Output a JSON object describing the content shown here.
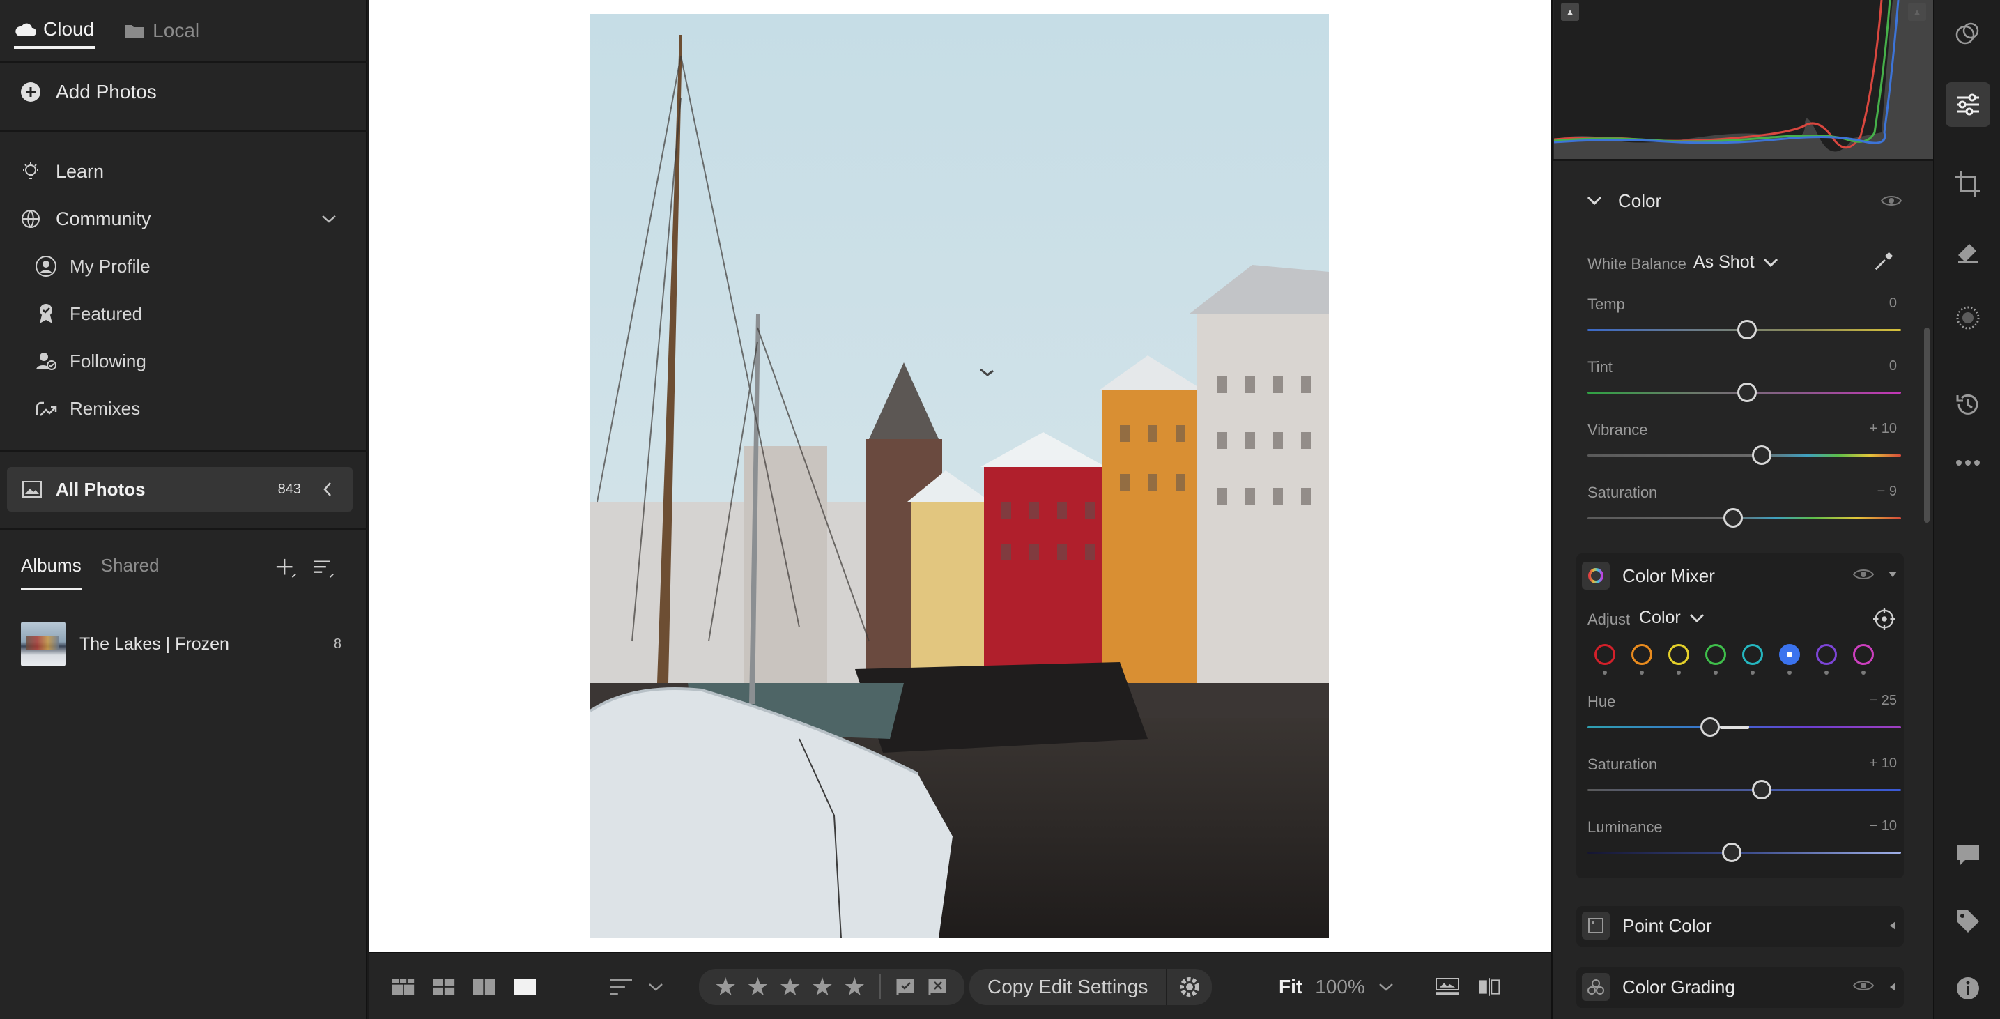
{
  "left_panel": {
    "tabs": [
      {
        "label": "Cloud",
        "icon": "cloud-icon",
        "active": true
      },
      {
        "label": "Local",
        "icon": "folder-icon",
        "active": false
      }
    ],
    "add_photos": "Add Photos",
    "nav": {
      "learn": "Learn",
      "community": "Community",
      "community_items": [
        "My Profile",
        "Featured",
        "Following",
        "Remixes"
      ]
    },
    "all_photos": {
      "label": "All Photos",
      "count": "843"
    },
    "album_tabs": [
      "Albums",
      "Shared"
    ],
    "albums": [
      {
        "name": "The Lakes | Frozen",
        "count": "8"
      }
    ]
  },
  "toolbar": {
    "rating_stars": 5,
    "copy_edit_settings": "Copy Edit Settings",
    "fit": "Fit",
    "zoom": "100%"
  },
  "right_panel": {
    "color": {
      "title": "Color",
      "white_balance_label": "White Balance",
      "white_balance_value": "As Shot",
      "sliders": [
        {
          "label": "Temp",
          "value": "0",
          "position": 0.5
        },
        {
          "label": "Tint",
          "value": "0",
          "position": 0.5
        },
        {
          "label": "Vibrance",
          "value": "+ 10",
          "position": 0.55
        },
        {
          "label": "Saturation",
          "value": "− 9",
          "position": 0.455
        }
      ]
    },
    "color_mixer": {
      "title": "Color Mixer",
      "adjust_label": "Adjust",
      "adjust_value": "Color",
      "swatches": [
        "#d3202a",
        "#e98b1e",
        "#e4d02a",
        "#3fbf4b",
        "#25b6bf",
        "#3b73ee",
        "#7c45d6",
        "#cc3fbe"
      ],
      "selected_swatch": 5,
      "sliders": [
        {
          "label": "Hue",
          "value": "− 25",
          "position": 0.375
        },
        {
          "label": "Saturation",
          "value": "+ 10",
          "position": 0.55
        },
        {
          "label": "Luminance",
          "value": "− 10",
          "position": 0.45
        }
      ]
    },
    "point_color": {
      "title": "Point Color"
    },
    "color_grading": {
      "title": "Color Grading"
    }
  },
  "icon_strip": [
    "presets-icon",
    "edit-sliders-icon",
    "crop-icon",
    "healing-eraser-icon",
    "masking-icon",
    "history-icon",
    "more-icon",
    "comments-icon",
    "tag-icon",
    "info-icon"
  ]
}
